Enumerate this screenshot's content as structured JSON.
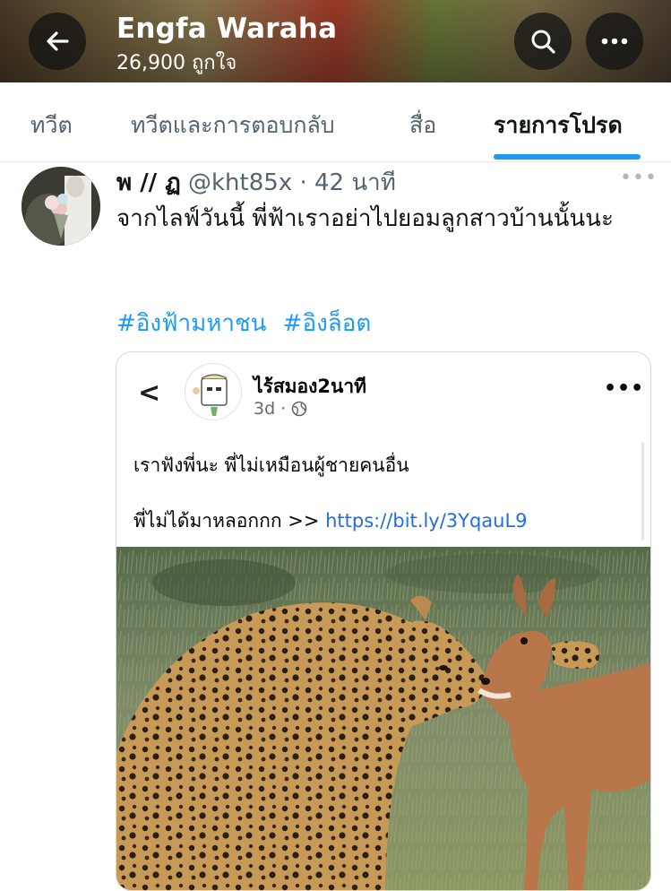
{
  "header": {
    "name": "Engfa Waraha",
    "likes": "26,900 ถูกใจ",
    "icons": [
      "arrow-left-icon",
      "search-icon",
      "more-horizontal-icon"
    ]
  },
  "tabs": [
    {
      "label": "ทวีต"
    },
    {
      "label": "ทวีตและการตอบกลับ"
    },
    {
      "label": "สื่อ"
    },
    {
      "label": "รายการโปรด",
      "active": true
    }
  ],
  "tweet": {
    "author_name": "พ // ฏ",
    "handle": "@kht85x",
    "time": "· 42 นาที",
    "more": "•••",
    "text": "จากไลฟ์วันนี้ พี่ฟ้าเราอย่าไปยอมลูกสาวบ้านนั้นนะ",
    "hashtags": [
      "#อิงฟ้ามหาชน",
      "#อิงล็อต"
    ]
  },
  "embedded_post": {
    "back": "<",
    "page_name": "ไร้สมอง2นาที",
    "age": "3d ·",
    "more": "•••",
    "line1": "เราฟังพี่นะ พี่ไม่เหมือนผู้ชายคนอื่น",
    "line2_text": "พี่ไม่ได้มาหลอกกก >> ",
    "line2_link": "https://bit.ly/3YqauL9"
  },
  "colors": {
    "accent": "#1d9bf0",
    "link": "#216fdb",
    "secondary_text": "#536471"
  }
}
